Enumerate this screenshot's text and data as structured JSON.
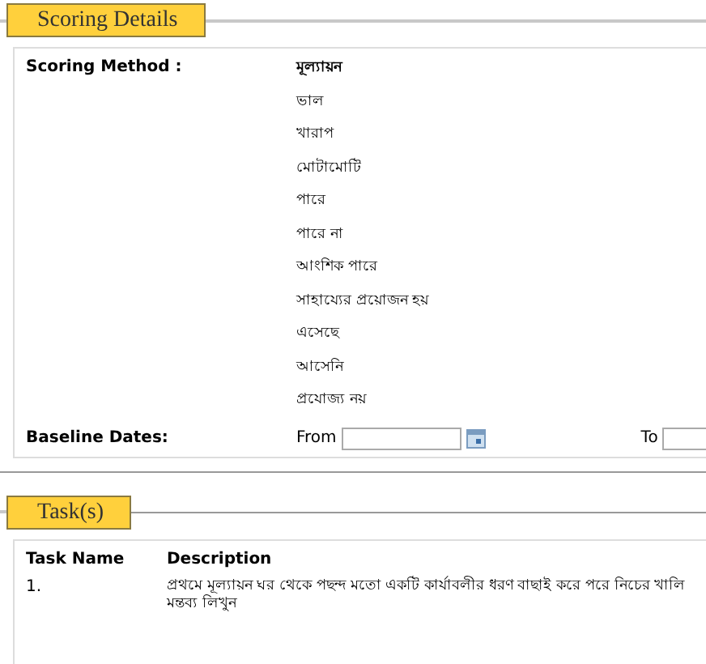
{
  "scoring_details": {
    "legend": "Scoring Details",
    "scoring_method_label": "Scoring Method :",
    "scoring_options": [
      {
        "text": "মূল্যায়ন",
        "kind": "heading"
      },
      {
        "text": "ভাল",
        "kind": "option"
      },
      {
        "text": "খারাপ",
        "kind": "option"
      },
      {
        "text": "মোটামোটি",
        "kind": "option"
      },
      {
        "text": "পারে",
        "kind": "option"
      },
      {
        "text": "পারে না",
        "kind": "option"
      },
      {
        "text": "আংশিক পারে",
        "kind": "option"
      },
      {
        "text": "সাহায্যের প্রয়োজন হয়",
        "kind": "option"
      },
      {
        "text": "এসেছে",
        "kind": "option"
      },
      {
        "text": "আসেনি",
        "kind": "option"
      },
      {
        "text": "প্রযোজ্য নয়",
        "kind": "option"
      }
    ],
    "baseline_dates_label": "Baseline Dates:",
    "from_label": "From",
    "to_label": "To"
  },
  "tasks": {
    "legend": "Task(s)",
    "columns": [
      "Task Name",
      "Description"
    ],
    "rows": [
      {
        "task_name": "1.",
        "description_lines": [
          "প্রথমে মূল্যায়ন ঘর থেকে পছন্দ মতো একটি কার্যাবলীর ধরণ বাছাই করে পরে নিচের খালি",
          "মন্তব্য লিখুন"
        ]
      }
    ]
  }
}
